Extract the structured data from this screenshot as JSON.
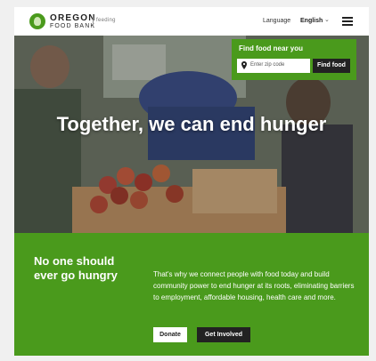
{
  "header": {
    "logo_line1": "OREGON",
    "logo_line2": "FOOD BANK",
    "partner_mark": "feeding",
    "language_label": "Language",
    "language_value": "English",
    "menu_icon": "hamburger-menu-icon"
  },
  "hero": {
    "title": "Together, we can end hunger",
    "find_food": {
      "title": "Find food near you",
      "placeholder": "Enter zip code",
      "button": "Find food"
    }
  },
  "mission": {
    "title": "No one should ever go hungry",
    "body": "That's why we connect people with food today and build community power to end hunger at its roots, eliminating barriers to employment, affordable housing, health care and more.",
    "donate_label": "Donate",
    "involved_label": "Get Involved"
  },
  "colors": {
    "brand_green": "#4a9a1c",
    "dark": "#222222"
  }
}
